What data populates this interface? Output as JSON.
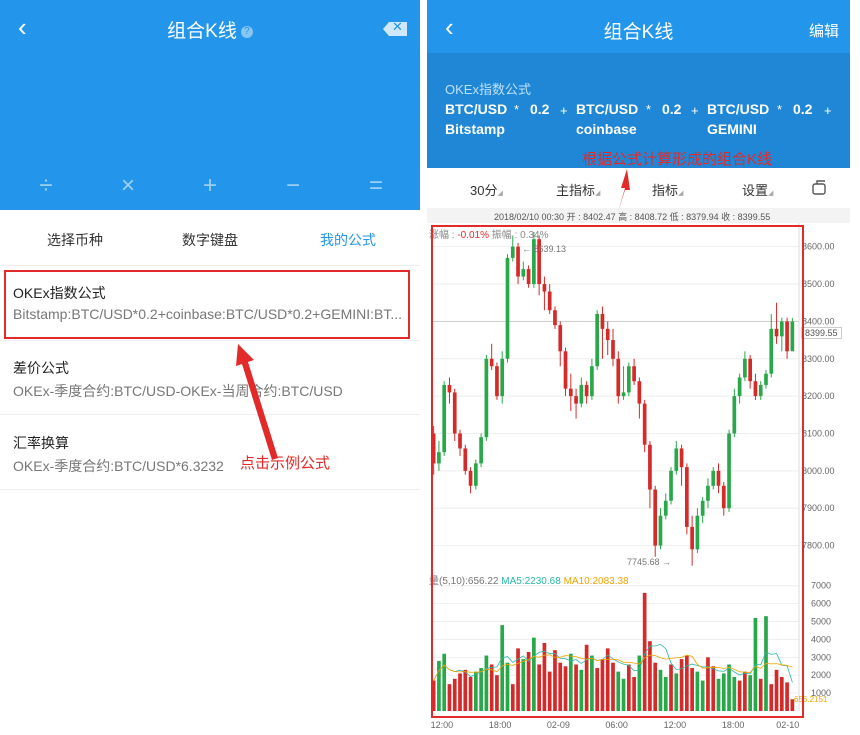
{
  "left": {
    "title": "组合K线",
    "help_glyph": "?",
    "back_glyph": "‹",
    "del_glyph": "✕",
    "operators": [
      "÷",
      "×",
      "+",
      "−",
      "="
    ],
    "tabs": [
      {
        "label": "选择币种",
        "active": false
      },
      {
        "label": "数字键盘",
        "active": false
      },
      {
        "label": "我的公式",
        "active": true
      }
    ],
    "formulas": [
      {
        "title": "OKEx指数公式",
        "expr": "Bitstamp:BTC/USD*0.2+coinbase:BTC/USD*0.2+GEMINI:BT..."
      },
      {
        "title": "差价公式",
        "expr": "OKEx-季度合约:BTC/USD-OKEx-当周合约:BTC/USD"
      },
      {
        "title": "汇率换算",
        "expr": "OKEx-季度合约:BTC/USD*6.3232"
      }
    ],
    "annotation": "点击示例公式"
  },
  "right": {
    "title": "组合K线",
    "edit": "编辑",
    "back_glyph": "‹",
    "formula_label": "OKEx指数公式",
    "terms": [
      {
        "pair": "BTC/USD",
        "source": "Bitstamp",
        "weight": "0.2"
      },
      {
        "pair": "BTC/USD",
        "source": "coinbase",
        "weight": "0.2"
      },
      {
        "pair": "BTC/USD",
        "source": "GEMINI",
        "weight": "0.2"
      }
    ],
    "mul": "*",
    "plus": "+",
    "annotation": "根据公式计算形成的组合K线",
    "toolbar": {
      "period": "30分",
      "main": "主指标",
      "indicator": "指标",
      "settings": "设置"
    },
    "ohlc": "2018/02/10 00:30  开 : 8402.47  高 : 8408.72  低 : 8379.94  收 : 8399.55",
    "change": "涨幅 : ",
    "change_val": "-0.01%",
    "amp": "  振幅 : 0.34%",
    "high_label": "← 8639.13",
    "low_label": "7745.68 →",
    "last_price": "8399.55",
    "vol_label": "量(5,10):656.22",
    "ma5": "MA5:2230.68",
    "ma10": "MA10:2083.38",
    "last_vol": "656.2151"
  },
  "chart_data": {
    "type": "candlestick",
    "price_axis": [
      "8600.00",
      "8500.00",
      "8400.00",
      "8300.00",
      "8200.00",
      "8100.00",
      "8000.00",
      "7900.00",
      "7800.00"
    ],
    "price_ticks": [
      8600,
      8500,
      8400,
      8300,
      8200,
      8100,
      8000,
      7900,
      7800
    ],
    "ylim": [
      7740,
      8650
    ],
    "volume_axis": [
      "7000",
      "6000",
      "5000",
      "4000",
      "3000",
      "2000",
      "1000"
    ],
    "volume_ticks": [
      7000,
      6000,
      5000,
      4000,
      3000,
      2000,
      1000
    ],
    "vol_lim": [
      0,
      7600
    ],
    "time_axis": [
      "12:00",
      "18:00",
      "02-09",
      "06:00",
      "12:00",
      "18:00",
      "02-10"
    ],
    "time_pos": [
      0.03,
      0.19,
      0.35,
      0.51,
      0.67,
      0.83,
      0.98
    ],
    "candles": [
      [
        8100,
        8020,
        8120,
        7990
      ],
      [
        8020,
        8050,
        8080,
        8000
      ],
      [
        8050,
        8230,
        8240,
        8040
      ],
      [
        8230,
        8210,
        8250,
        8180
      ],
      [
        8210,
        8100,
        8220,
        8080
      ],
      [
        8100,
        8060,
        8110,
        8040
      ],
      [
        8060,
        8000,
        8070,
        7990
      ],
      [
        8000,
        7960,
        8010,
        7940
      ],
      [
        7960,
        8020,
        8030,
        7950
      ],
      [
        8020,
        8090,
        8100,
        8010
      ],
      [
        8090,
        8300,
        8310,
        8080
      ],
      [
        8300,
        8280,
        8340,
        8270
      ],
      [
        8280,
        8200,
        8290,
        8190
      ],
      [
        8200,
        8300,
        8320,
        8180
      ],
      [
        8300,
        8570,
        8580,
        8290
      ],
      [
        8570,
        8600,
        8630,
        8560
      ],
      [
        8600,
        8520,
        8610,
        8500
      ],
      [
        8520,
        8540,
        8560,
        8510
      ],
      [
        8540,
        8500,
        8550,
        8490
      ],
      [
        8500,
        8620,
        8639,
        8490
      ],
      [
        8620,
        8500,
        8630,
        8470
      ],
      [
        8500,
        8480,
        8520,
        8430
      ],
      [
        8480,
        8430,
        8500,
        8420
      ],
      [
        8430,
        8390,
        8440,
        8380
      ],
      [
        8390,
        8320,
        8400,
        8280
      ],
      [
        8320,
        8220,
        8330,
        8200
      ],
      [
        8220,
        8200,
        8260,
        8160
      ],
      [
        8200,
        8180,
        8220,
        8140
      ],
      [
        8180,
        8230,
        8250,
        8170
      ],
      [
        8230,
        8200,
        8240,
        8180
      ],
      [
        8200,
        8280,
        8300,
        8190
      ],
      [
        8280,
        8420,
        8430,
        8270
      ],
      [
        8420,
        8380,
        8440,
        8300
      ],
      [
        8380,
        8350,
        8400,
        8310
      ],
      [
        8350,
        8300,
        8380,
        8280
      ],
      [
        8300,
        8200,
        8320,
        8180
      ],
      [
        8200,
        8210,
        8280,
        8190
      ],
      [
        8210,
        8280,
        8290,
        8200
      ],
      [
        8280,
        8240,
        8300,
        8230
      ],
      [
        8240,
        8180,
        8250,
        8140
      ],
      [
        8180,
        8070,
        8190,
        8050
      ],
      [
        8070,
        7950,
        8080,
        7900
      ],
      [
        7950,
        7800,
        7960,
        7770
      ],
      [
        7800,
        7880,
        7900,
        7790
      ],
      [
        7880,
        7920,
        7940,
        7870
      ],
      [
        7920,
        8000,
        8010,
        7910
      ],
      [
        8000,
        8060,
        8080,
        7990
      ],
      [
        8060,
        8010,
        8070,
        7960
      ],
      [
        8010,
        7850,
        8020,
        7830
      ],
      [
        7850,
        7790,
        7880,
        7746
      ],
      [
        7790,
        7880,
        7900,
        7780
      ],
      [
        7880,
        7920,
        7930,
        7860
      ],
      [
        7920,
        7960,
        7980,
        7900
      ],
      [
        7960,
        8000,
        8010,
        7950
      ],
      [
        8000,
        7960,
        8020,
        7940
      ],
      [
        7960,
        7900,
        7970,
        7880
      ],
      [
        7900,
        8100,
        8110,
        7890
      ],
      [
        8100,
        8200,
        8220,
        8090
      ],
      [
        8200,
        8250,
        8260,
        8180
      ],
      [
        8250,
        8300,
        8320,
        8240
      ],
      [
        8300,
        8240,
        8310,
        8220
      ],
      [
        8240,
        8200,
        8260,
        8190
      ],
      [
        8200,
        8230,
        8240,
        8190
      ],
      [
        8230,
        8260,
        8270,
        8220
      ],
      [
        8260,
        8380,
        8420,
        8250
      ],
      [
        8380,
        8360,
        8450,
        8340
      ],
      [
        8360,
        8400,
        8410,
        8320
      ],
      [
        8400,
        8320,
        8410,
        8300
      ],
      [
        8320,
        8399.55,
        8408.72,
        8379.94
      ]
    ],
    "volumes": [
      [
        1700,
        0
      ],
      [
        2800,
        1
      ],
      [
        3200,
        1
      ],
      [
        1500,
        0
      ],
      [
        1800,
        0
      ],
      [
        2100,
        0
      ],
      [
        2300,
        0
      ],
      [
        1900,
        0
      ],
      [
        2200,
        1
      ],
      [
        2400,
        1
      ],
      [
        3100,
        1
      ],
      [
        2600,
        0
      ],
      [
        2000,
        0
      ],
      [
        4800,
        1
      ],
      [
        2700,
        1
      ],
      [
        1500,
        0
      ],
      [
        3500,
        0
      ],
      [
        2900,
        1
      ],
      [
        3300,
        0
      ],
      [
        4100,
        1
      ],
      [
        2600,
        0
      ],
      [
        3800,
        0
      ],
      [
        2200,
        0
      ],
      [
        3400,
        0
      ],
      [
        2700,
        0
      ],
      [
        2500,
        0
      ],
      [
        3200,
        1
      ],
      [
        2600,
        0
      ],
      [
        2300,
        1
      ],
      [
        3700,
        0
      ],
      [
        3100,
        1
      ],
      [
        2400,
        0
      ],
      [
        2900,
        0
      ],
      [
        3500,
        0
      ],
      [
        2700,
        0
      ],
      [
        2200,
        1
      ],
      [
        1800,
        1
      ],
      [
        2600,
        0
      ],
      [
        1900,
        0
      ],
      [
        3100,
        1
      ],
      [
        6600,
        0
      ],
      [
        3900,
        0
      ],
      [
        2700,
        0
      ],
      [
        2300,
        1
      ],
      [
        1900,
        1
      ],
      [
        2600,
        0
      ],
      [
        2100,
        1
      ],
      [
        2900,
        0
      ],
      [
        3100,
        0
      ],
      [
        2400,
        0
      ],
      [
        2200,
        1
      ],
      [
        1700,
        1
      ],
      [
        3000,
        0
      ],
      [
        2500,
        0
      ],
      [
        1800,
        1
      ],
      [
        2100,
        1
      ],
      [
        2600,
        1
      ],
      [
        1900,
        1
      ],
      [
        1700,
        0
      ],
      [
        2200,
        0
      ],
      [
        2000,
        1
      ],
      [
        5200,
        1
      ],
      [
        1800,
        0
      ],
      [
        5300,
        1
      ],
      [
        1500,
        0
      ],
      [
        2300,
        0
      ],
      [
        1900,
        0
      ],
      [
        1600,
        0
      ],
      [
        656,
        0
      ]
    ]
  }
}
